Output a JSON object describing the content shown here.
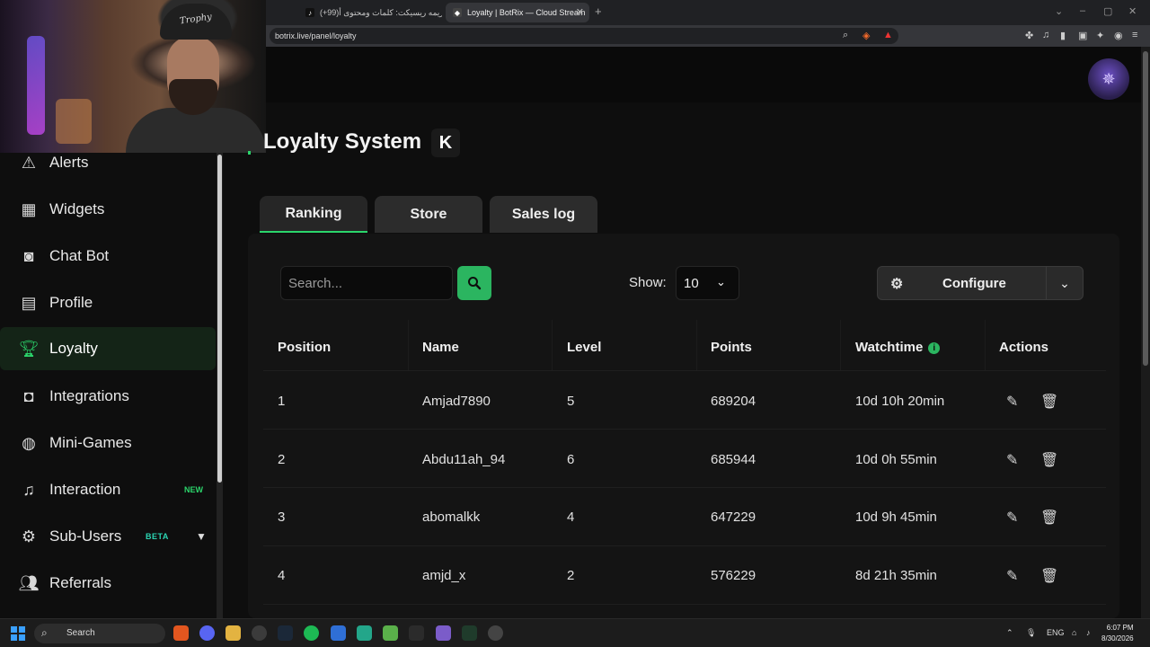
{
  "browser": {
    "tabs": [
      {
        "label": "(+99)دريمه ريسيكت: كلمات ومحتوى أ",
        "active": false
      },
      {
        "label": "Loyalty | BotRix — Cloud Stream",
        "active": true
      }
    ],
    "url": "botrix.live/panel/loyalty"
  },
  "sidebar": {
    "items": [
      {
        "label": "Alerts",
        "icon": "warning-icon",
        "active": false
      },
      {
        "label": "Widgets",
        "icon": "widgets-grid-icon",
        "active": false
      },
      {
        "label": "Chat Bot",
        "icon": "robot-icon",
        "active": false
      },
      {
        "label": "Profile",
        "icon": "id-card-icon",
        "active": false
      },
      {
        "label": "Loyalty",
        "icon": "trophy-icon",
        "active": true
      },
      {
        "label": "Integrations",
        "icon": "discord-icon",
        "active": false
      },
      {
        "label": "Mini-Games",
        "icon": "gamepad-icon",
        "active": false
      },
      {
        "label": "Interaction",
        "icon": "music-note-icon",
        "active": false,
        "badge": "NEW"
      },
      {
        "label": "Sub-Users",
        "icon": "users-cog-icon",
        "active": false,
        "badge": "BETA"
      },
      {
        "label": "Referrals",
        "icon": "user-group-icon",
        "active": false
      }
    ]
  },
  "page": {
    "title": "Loyalty System",
    "platform_badge": "K",
    "tabs": [
      {
        "label": "Ranking",
        "active": true
      },
      {
        "label": "Store",
        "active": false
      },
      {
        "label": "Sales log",
        "active": false
      }
    ]
  },
  "toolbar": {
    "search_placeholder": "Search...",
    "show_label": "Show:",
    "show_value": "10",
    "configure_label": "Configure"
  },
  "table": {
    "columns": [
      "Position",
      "Name",
      "Level",
      "Points",
      "Watchtime",
      "Actions"
    ],
    "rows": [
      {
        "position": "1",
        "name": "Amjad7890",
        "level": "5",
        "points": "689204",
        "watchtime": "10d 10h 20min"
      },
      {
        "position": "2",
        "name": "Abdu11ah_94",
        "level": "6",
        "points": "685944",
        "watchtime": "10d 0h 55min"
      },
      {
        "position": "3",
        "name": "abomalkk",
        "level": "4",
        "points": "647229",
        "watchtime": "10d 9h 45min"
      },
      {
        "position": "4",
        "name": "amjd_x",
        "level": "2",
        "points": "576229",
        "watchtime": "8d 21h 35min"
      }
    ]
  },
  "taskbar": {
    "search_label": "Search",
    "language": "ENG",
    "time": "6:07 PM",
    "date": "8/30/2026"
  },
  "colors": {
    "accent": "#2bd56b",
    "background": "#0e0e0e",
    "card": "#141414"
  }
}
